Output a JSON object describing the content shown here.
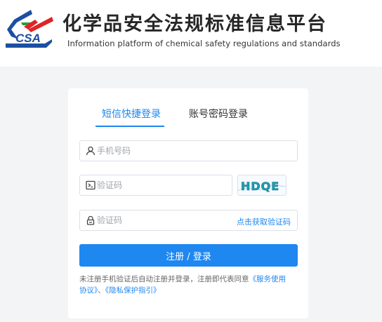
{
  "header": {
    "logo_text": "CSA",
    "title": "化学品安全法规标准信息平台",
    "subtitle": "Information platform of chemical safety regulations and standards"
  },
  "login": {
    "tabs": [
      {
        "label": "短信快捷登录",
        "active": true
      },
      {
        "label": "账号密码登录",
        "active": false
      }
    ],
    "phone_placeholder": "手机号码",
    "captcha_placeholder": "验证码",
    "captcha_image_text": "HDQE",
    "sms_placeholder": "验证码",
    "get_code_label": "点击获取验证码",
    "submit_label": "注册 / 登录",
    "notice_prefix": "未注册手机验证后自动注册并登录，注册即代表同意",
    "terms_link": "《服务使用协议》",
    "separator": "、",
    "privacy_link": "《隐私保护指引》"
  },
  "colors": {
    "accent": "#1e87f0",
    "logo_blue": "#1b4fa3",
    "logo_red": "#e02424",
    "logo_green": "#2a9d3c",
    "background": "#f3f4f6"
  },
  "icons": {
    "phone": "user-icon",
    "captcha": "terminal-icon",
    "sms": "lock-icon"
  }
}
